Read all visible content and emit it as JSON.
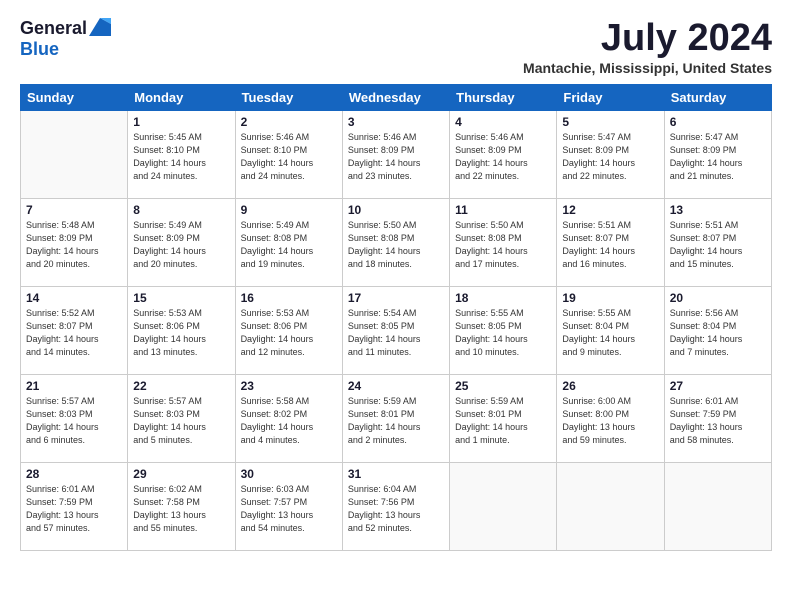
{
  "logo": {
    "general": "General",
    "blue": "Blue"
  },
  "title": "July 2024",
  "location": "Mantachie, Mississippi, United States",
  "days_of_week": [
    "Sunday",
    "Monday",
    "Tuesday",
    "Wednesday",
    "Thursday",
    "Friday",
    "Saturday"
  ],
  "weeks": [
    [
      {
        "day": "",
        "info": ""
      },
      {
        "day": "1",
        "info": "Sunrise: 5:45 AM\nSunset: 8:10 PM\nDaylight: 14 hours\nand 24 minutes."
      },
      {
        "day": "2",
        "info": "Sunrise: 5:46 AM\nSunset: 8:10 PM\nDaylight: 14 hours\nand 24 minutes."
      },
      {
        "day": "3",
        "info": "Sunrise: 5:46 AM\nSunset: 8:09 PM\nDaylight: 14 hours\nand 23 minutes."
      },
      {
        "day": "4",
        "info": "Sunrise: 5:46 AM\nSunset: 8:09 PM\nDaylight: 14 hours\nand 22 minutes."
      },
      {
        "day": "5",
        "info": "Sunrise: 5:47 AM\nSunset: 8:09 PM\nDaylight: 14 hours\nand 22 minutes."
      },
      {
        "day": "6",
        "info": "Sunrise: 5:47 AM\nSunset: 8:09 PM\nDaylight: 14 hours\nand 21 minutes."
      }
    ],
    [
      {
        "day": "7",
        "info": "Sunrise: 5:48 AM\nSunset: 8:09 PM\nDaylight: 14 hours\nand 20 minutes."
      },
      {
        "day": "8",
        "info": "Sunrise: 5:49 AM\nSunset: 8:09 PM\nDaylight: 14 hours\nand 20 minutes."
      },
      {
        "day": "9",
        "info": "Sunrise: 5:49 AM\nSunset: 8:08 PM\nDaylight: 14 hours\nand 19 minutes."
      },
      {
        "day": "10",
        "info": "Sunrise: 5:50 AM\nSunset: 8:08 PM\nDaylight: 14 hours\nand 18 minutes."
      },
      {
        "day": "11",
        "info": "Sunrise: 5:50 AM\nSunset: 8:08 PM\nDaylight: 14 hours\nand 17 minutes."
      },
      {
        "day": "12",
        "info": "Sunrise: 5:51 AM\nSunset: 8:07 PM\nDaylight: 14 hours\nand 16 minutes."
      },
      {
        "day": "13",
        "info": "Sunrise: 5:51 AM\nSunset: 8:07 PM\nDaylight: 14 hours\nand 15 minutes."
      }
    ],
    [
      {
        "day": "14",
        "info": "Sunrise: 5:52 AM\nSunset: 8:07 PM\nDaylight: 14 hours\nand 14 minutes."
      },
      {
        "day": "15",
        "info": "Sunrise: 5:53 AM\nSunset: 8:06 PM\nDaylight: 14 hours\nand 13 minutes."
      },
      {
        "day": "16",
        "info": "Sunrise: 5:53 AM\nSunset: 8:06 PM\nDaylight: 14 hours\nand 12 minutes."
      },
      {
        "day": "17",
        "info": "Sunrise: 5:54 AM\nSunset: 8:05 PM\nDaylight: 14 hours\nand 11 minutes."
      },
      {
        "day": "18",
        "info": "Sunrise: 5:55 AM\nSunset: 8:05 PM\nDaylight: 14 hours\nand 10 minutes."
      },
      {
        "day": "19",
        "info": "Sunrise: 5:55 AM\nSunset: 8:04 PM\nDaylight: 14 hours\nand 9 minutes."
      },
      {
        "day": "20",
        "info": "Sunrise: 5:56 AM\nSunset: 8:04 PM\nDaylight: 14 hours\nand 7 minutes."
      }
    ],
    [
      {
        "day": "21",
        "info": "Sunrise: 5:57 AM\nSunset: 8:03 PM\nDaylight: 14 hours\nand 6 minutes."
      },
      {
        "day": "22",
        "info": "Sunrise: 5:57 AM\nSunset: 8:03 PM\nDaylight: 14 hours\nand 5 minutes."
      },
      {
        "day": "23",
        "info": "Sunrise: 5:58 AM\nSunset: 8:02 PM\nDaylight: 14 hours\nand 4 minutes."
      },
      {
        "day": "24",
        "info": "Sunrise: 5:59 AM\nSunset: 8:01 PM\nDaylight: 14 hours\nand 2 minutes."
      },
      {
        "day": "25",
        "info": "Sunrise: 5:59 AM\nSunset: 8:01 PM\nDaylight: 14 hours\nand 1 minute."
      },
      {
        "day": "26",
        "info": "Sunrise: 6:00 AM\nSunset: 8:00 PM\nDaylight: 13 hours\nand 59 minutes."
      },
      {
        "day": "27",
        "info": "Sunrise: 6:01 AM\nSunset: 7:59 PM\nDaylight: 13 hours\nand 58 minutes."
      }
    ],
    [
      {
        "day": "28",
        "info": "Sunrise: 6:01 AM\nSunset: 7:59 PM\nDaylight: 13 hours\nand 57 minutes."
      },
      {
        "day": "29",
        "info": "Sunrise: 6:02 AM\nSunset: 7:58 PM\nDaylight: 13 hours\nand 55 minutes."
      },
      {
        "day": "30",
        "info": "Sunrise: 6:03 AM\nSunset: 7:57 PM\nDaylight: 13 hours\nand 54 minutes."
      },
      {
        "day": "31",
        "info": "Sunrise: 6:04 AM\nSunset: 7:56 PM\nDaylight: 13 hours\nand 52 minutes."
      },
      {
        "day": "",
        "info": ""
      },
      {
        "day": "",
        "info": ""
      },
      {
        "day": "",
        "info": ""
      }
    ]
  ]
}
